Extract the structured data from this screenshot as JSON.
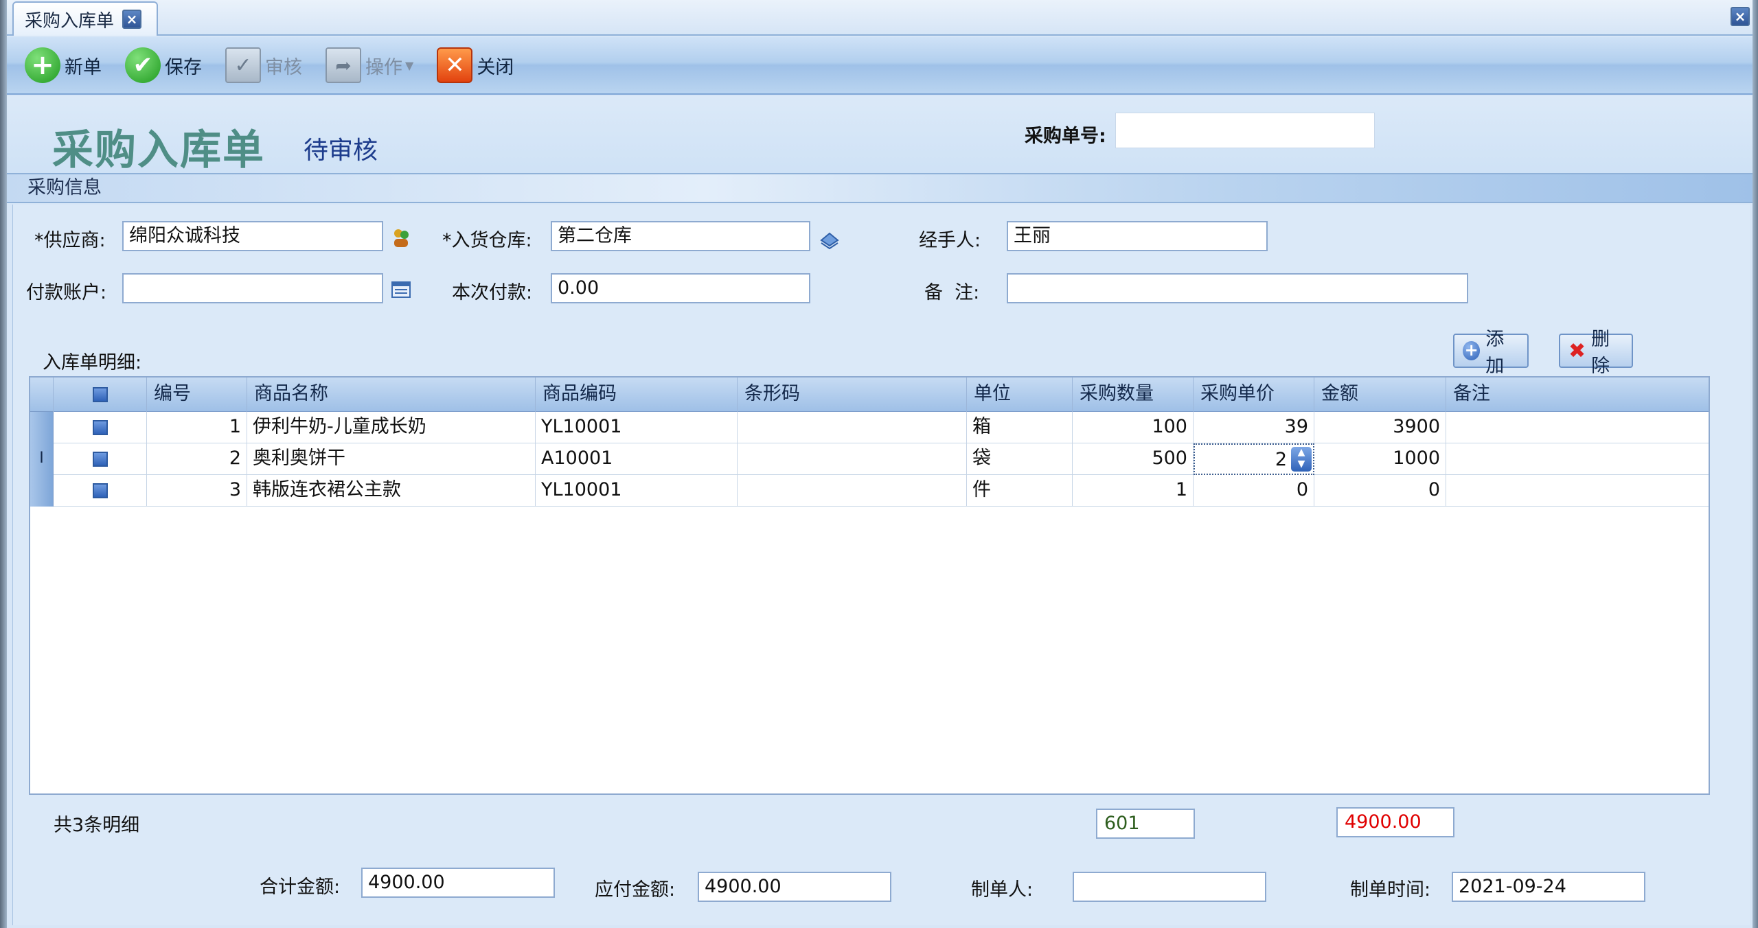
{
  "tab": {
    "label": "采购入库单"
  },
  "toolbar": {
    "new_label": "新单",
    "save_label": "保存",
    "audit_label": "审核",
    "ops_label": "操作",
    "close_label": "关闭"
  },
  "header": {
    "title": "采购入库单",
    "status": "待审核",
    "order_no_label": "采购单号:",
    "order_no_value": ""
  },
  "section": {
    "title": "采购信息"
  },
  "form": {
    "supplier_label": "*供应商:",
    "supplier_value": "绵阳众诚科技",
    "warehouse_label": "*入货仓库:",
    "warehouse_value": "第二仓库",
    "handler_label": "经手人:",
    "handler_value": "王丽",
    "account_label": "付款账户:",
    "account_value": "",
    "payment_label": "本次付款:",
    "payment_value": "0.00",
    "remark_label": "备  注:",
    "remark_value": ""
  },
  "detail": {
    "title": "入库单明细:",
    "add_label": "添加",
    "delete_label": "删除",
    "columns": [
      "编号",
      "商品名称",
      "商品编码",
      "条形码",
      "单位",
      "采购数量",
      "采购单价",
      "金额",
      "备注"
    ],
    "rows": [
      {
        "no": "1",
        "name": "伊利牛奶-儿童成长奶",
        "code": "YL10001",
        "barcode": "",
        "unit": "箱",
        "qty": "100",
        "price": "39",
        "amount": "3900",
        "remark": ""
      },
      {
        "no": "2",
        "name": "奥利奥饼干",
        "code": "A10001",
        "barcode": "",
        "unit": "袋",
        "qty": "500",
        "price": "2",
        "amount": "1000",
        "remark": ""
      },
      {
        "no": "3",
        "name": "韩版连衣裙公主款",
        "code": "YL10001",
        "barcode": "",
        "unit": "件",
        "qty": "1",
        "price": "0",
        "amount": "0",
        "remark": ""
      }
    ],
    "row_count_text": "共3条明细",
    "qty_total": "601",
    "amount_total": "4900.00"
  },
  "footer": {
    "total_label": "合计金额:",
    "total_value": "4900.00",
    "payable_label": "应付金额:",
    "payable_value": "4900.00",
    "maker_label": "制单人:",
    "maker_value": "",
    "time_label": "制单时间:",
    "time_value": "2021-09-24"
  },
  "colors": {
    "title": "#4f8e86",
    "status": "#1d3c8c",
    "amount_total": "#e00000",
    "qty_total": "#2e5e1e"
  }
}
